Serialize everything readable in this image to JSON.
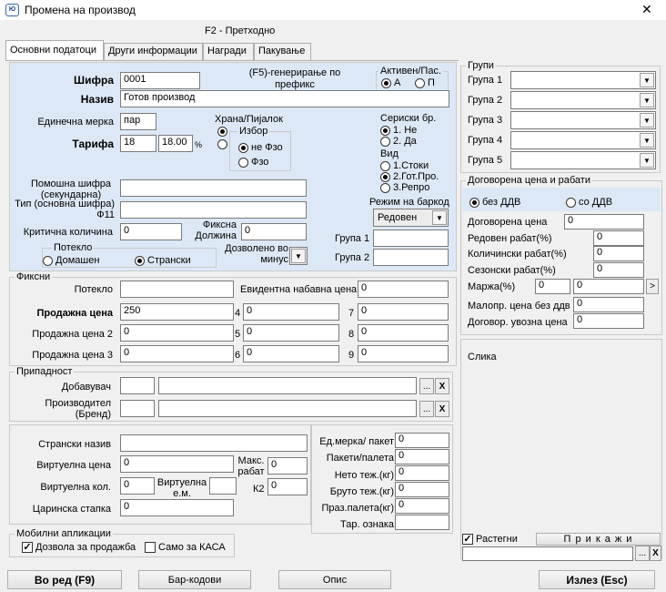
{
  "window": {
    "title": "Промена на производ",
    "close": "✕"
  },
  "mode_label": "F2 - Претходно",
  "tabs": [
    "Основни податоци",
    "Други информации",
    "Награди",
    "Пакување"
  ],
  "top": {
    "sifra_label": "Шифра",
    "sifra_value": "0001",
    "f5_label": "(F5)-генерирање по префикс",
    "aktiven_label": "Активен/Пас.",
    "aktiven_a": "А",
    "aktiven_p": "П",
    "naziv_label": "Назив",
    "naziv_value": "Готов производ",
    "edinecna_label": "Единечна мерка",
    "edinecna_value": "пар",
    "tarifa_label": "Тарифа",
    "tarifa_value": "18",
    "tarifa_pct": "18.00",
    "pct": "%",
    "hrana_label": "Храна/Пијалок",
    "izbor_label": "Избор",
    "izbor_opt1": "не Фзо",
    "izbor_opt2": "Фзо",
    "serijski_label": "Сериски бр.",
    "serijski_opt1": "1. Не",
    "serijski_opt2": "2. Да",
    "vid_label": "Вид",
    "vid_opt1": "1.Стоки",
    "vid_opt2": "2.Гот.Про.",
    "vid_opt3": "3.Репро",
    "rezim_label": "Режим на баркод",
    "rezim_value": "Редовен",
    "pomosna_label": "Помошна шифра (секундарна)",
    "tip_label": "Тип (основна шифра) Ф11",
    "kriticna_label": "Критична количина",
    "kriticna_value": "0",
    "fiksna_label": "Фиксна Должина",
    "fiksna_value": "0",
    "potekla_label": "Потекло",
    "potekla_opt1": "Домашен",
    "potekla_opt2": "Странски",
    "dozvoleno_label": "Дозволено во минус",
    "grupa1_label": "Група 1",
    "grupa2_label": "Група 2"
  },
  "fiksni": {
    "title": "Фиксни",
    "poteklo_label": "Потекло",
    "evid_label": "Евидентна набавна цена",
    "evid_value": "0",
    "pc_label": "Продажна цена",
    "pc_value": "250",
    "pc2_label": "Продажна цена 2",
    "pc2_value": "0",
    "pc3_label": "Продажна цена 3",
    "pc3_value": "0",
    "n4": "4",
    "v4": "0",
    "n5": "5",
    "v5": "0",
    "n6": "6",
    "v6": "0",
    "n7": "7",
    "v7": "0",
    "n8": "8",
    "v8": "0",
    "n9": "9",
    "v9": "0"
  },
  "pripadnost": {
    "title": "Припадност",
    "dobavuvac": "Добавувач",
    "proizvoditel": "Производител (Бренд)",
    "dots": "...",
    "x": "X"
  },
  "extra": {
    "stranski": "Странски назив",
    "virt_cena": "Виртуелна цена",
    "virt_cena_value": "0",
    "maks_rabat": "Макс. рабат",
    "maks_rabat_value": "0",
    "virt_kol": "Виртуелна кол.",
    "virt_kol_value": "0",
    "virt_em": "Виртуелна е.м.",
    "k2": "К2",
    "k2_value": "0",
    "carinska": "Царинска стапка",
    "carinska_value": "0",
    "ed_merka": "Ед.мерка/ пакет",
    "ed_merka_value": "0",
    "paketi": "Пакети/палета",
    "paketi_value": "0",
    "neto": "Нето теж.(кг)",
    "neto_value": "0",
    "bruto": "Бруто теж.(кг)",
    "bruto_value": "0",
    "praz": "Праз.палета(кг)",
    "praz_value": "0",
    "tar": "Тар. ознака",
    "tar_value": ""
  },
  "mobilni": {
    "title": "Мобилни апликации",
    "dozvola": "Дозвола за продажба",
    "samo": "Само за КАСА",
    "check": "✓"
  },
  "grupi": {
    "title": "Групи",
    "items": [
      "Група 1",
      "Група 2",
      "Група 3",
      "Група 4",
      "Група 5"
    ]
  },
  "dogovorena": {
    "title": "Договорена цена и рабати",
    "bez": "без ДДВ",
    "so": "со ДДВ",
    "dog_cena": "Договорена цена",
    "dog_cena_value": "0",
    "redoven": "Редовен рабат(%)",
    "redoven_value": "0",
    "kolicinski": "Количински рабат(%)",
    "kolicinski_value": "0",
    "sezonski": "Сезонски рабат(%)",
    "sezonski_value": "0",
    "marza": "Маржа(%)",
    "marza_value": "0",
    "marza_value2": "0",
    "malopr": "Малопр. цена без ддв",
    "malopr_value": "0",
    "dogovor_uv": "Договор. увозна цена",
    "dogovor_uv_value": "0"
  },
  "slika": {
    "title": "Слика",
    "rastegni": "Растегни",
    "prikazi": "П р и к а ж и"
  },
  "buttons": {
    "vo_red": "Во ред (F9)",
    "bar": "Бар-кодови",
    "opis": "Опис",
    "izlez": "Излез (Esc)"
  }
}
